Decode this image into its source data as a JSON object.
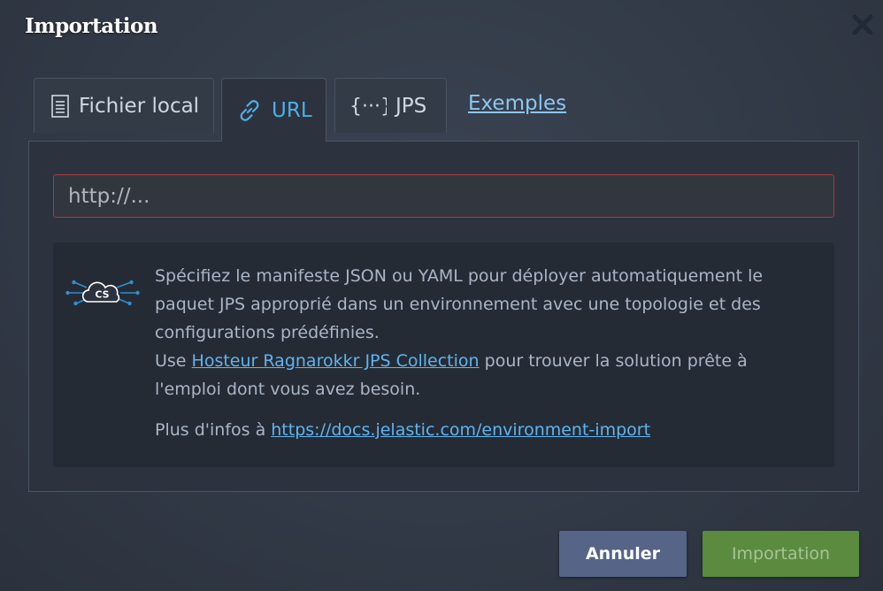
{
  "dialog": {
    "title": "Importation",
    "close_icon": "close-icon"
  },
  "tabs": [
    {
      "label": "Fichier local",
      "icon": "document-icon",
      "active": false
    },
    {
      "label": "URL",
      "icon": "link-icon",
      "active": true
    },
    {
      "label": "JPS",
      "icon": "braces-icon",
      "active": false
    }
  ],
  "examples_link": "Exemples",
  "url_input": {
    "placeholder": "http://...",
    "value": ""
  },
  "info": {
    "icon": "cloud-cs-icon",
    "icon_label": "CS",
    "line1": "Spécifiez le manifeste JSON ou YAML pour déployer automatiquement le paquet JPS approprié dans un environnement avec une topologie et des configurations prédéfinies.",
    "use_prefix": "Use ",
    "collection_link": "Hosteur Ragnarokkr JPS Collection",
    "use_suffix": " pour trouver la solution prête à l'emploi dont vous avez besoin.",
    "more_prefix": "Plus d'infos à ",
    "docs_link": "https://docs.jelastic.com/environment-import"
  },
  "buttons": {
    "cancel": "Annuler",
    "import": "Importation"
  },
  "colors": {
    "accent": "#4faee6",
    "link": "#5fb4ef",
    "error_border": "#a83a3f",
    "cancel_bg": "#566488",
    "import_bg": "#5b8b3f"
  }
}
